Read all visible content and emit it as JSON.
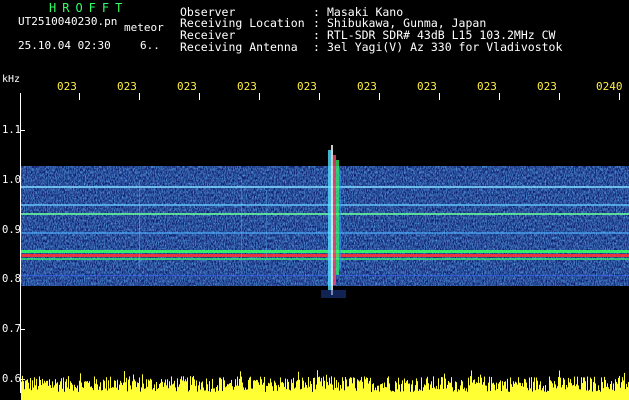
{
  "header": {
    "brand": "HROFFT",
    "filename": "UT2510040230.pn",
    "meteor_label": "meteor",
    "datetime": "25.10.04 02:30",
    "count": "6.."
  },
  "meta": [
    {
      "label": "Observer",
      "sep": ":",
      "value": "Masaki Kano"
    },
    {
      "label": "Receiving Location",
      "sep": ":",
      "value": "Shibukawa, Gunma, Japan"
    },
    {
      "label": "Receiver",
      "sep": ":",
      "value": "RTL-SDR SDR# 43dB L15 103.2MHz CW"
    },
    {
      "label": "Receiving Antenna",
      "sep": ":",
      "value": "3el Yagi(V) Az 330 for Vladivostok"
    }
  ],
  "axis": {
    "unit": "kHz",
    "time_labels": [
      "023",
      "023",
      "023",
      "023",
      "023",
      "023",
      "023",
      "023",
      "023",
      "0240"
    ],
    "freq_labels": [
      "1.1",
      "1.0",
      "0.9",
      "0.8",
      "0.7",
      "0.6"
    ]
  },
  "colors": {
    "noise_low": "#1a2a9a",
    "noise_mid": "#2aa0ff",
    "carrier_green": "#33ff66",
    "carrier_red": "#ff3333",
    "power_bar": "#ffff33"
  }
}
